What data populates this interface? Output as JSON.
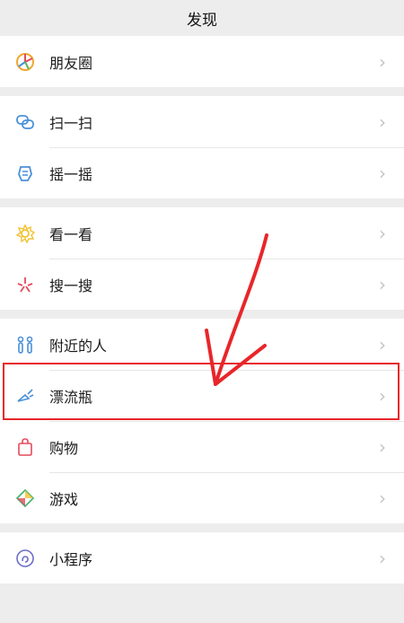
{
  "header": {
    "title": "发现"
  },
  "groups": [
    {
      "items": [
        {
          "label": "朋友圈",
          "icon": "moments-icon"
        }
      ]
    },
    {
      "items": [
        {
          "label": "扫一扫",
          "icon": "scan-icon"
        },
        {
          "label": "摇一摇",
          "icon": "shake-icon"
        }
      ]
    },
    {
      "items": [
        {
          "label": "看一看",
          "icon": "top-stories-icon"
        },
        {
          "label": "搜一搜",
          "icon": "search-icon"
        }
      ]
    },
    {
      "items": [
        {
          "label": "附近的人",
          "icon": "people-nearby-icon"
        },
        {
          "label": "漂流瓶",
          "icon": "drift-bottle-icon"
        },
        {
          "label": "购物",
          "icon": "shopping-bag-icon"
        },
        {
          "label": "游戏",
          "icon": "games-icon"
        }
      ]
    },
    {
      "items": [
        {
          "label": "小程序",
          "icon": "mini-programs-icon"
        }
      ]
    }
  ],
  "chevron": "›",
  "colors": {
    "annotation": "#e8262a",
    "background": "#ededed"
  }
}
